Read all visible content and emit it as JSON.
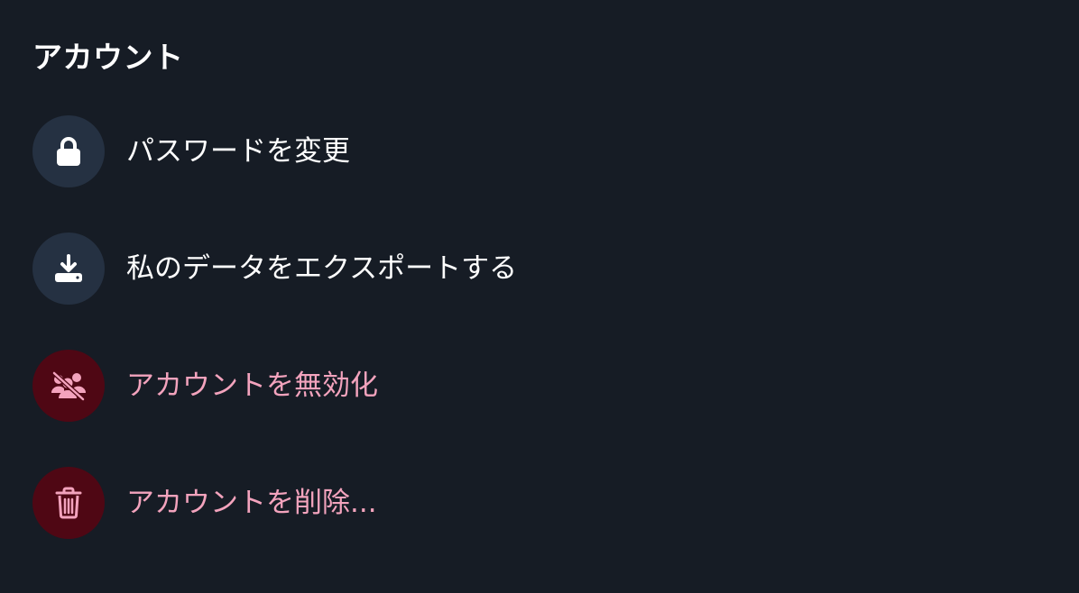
{
  "section": {
    "title": "アカウント"
  },
  "items": [
    {
      "label": "パスワードを変更",
      "icon": "lock-icon",
      "variant": "neutral"
    },
    {
      "label": "私のデータをエクスポートする",
      "icon": "download-icon",
      "variant": "neutral"
    },
    {
      "label": "アカウントを無効化",
      "icon": "users-slash-icon",
      "variant": "danger"
    },
    {
      "label": "アカウントを削除...",
      "icon": "trash-icon",
      "variant": "danger"
    }
  ],
  "colors": {
    "background": "#161c25",
    "neutral_circle": "#253142",
    "danger_circle": "#4f0714",
    "danger_text": "#f3a3bd",
    "text": "#ffffff"
  }
}
